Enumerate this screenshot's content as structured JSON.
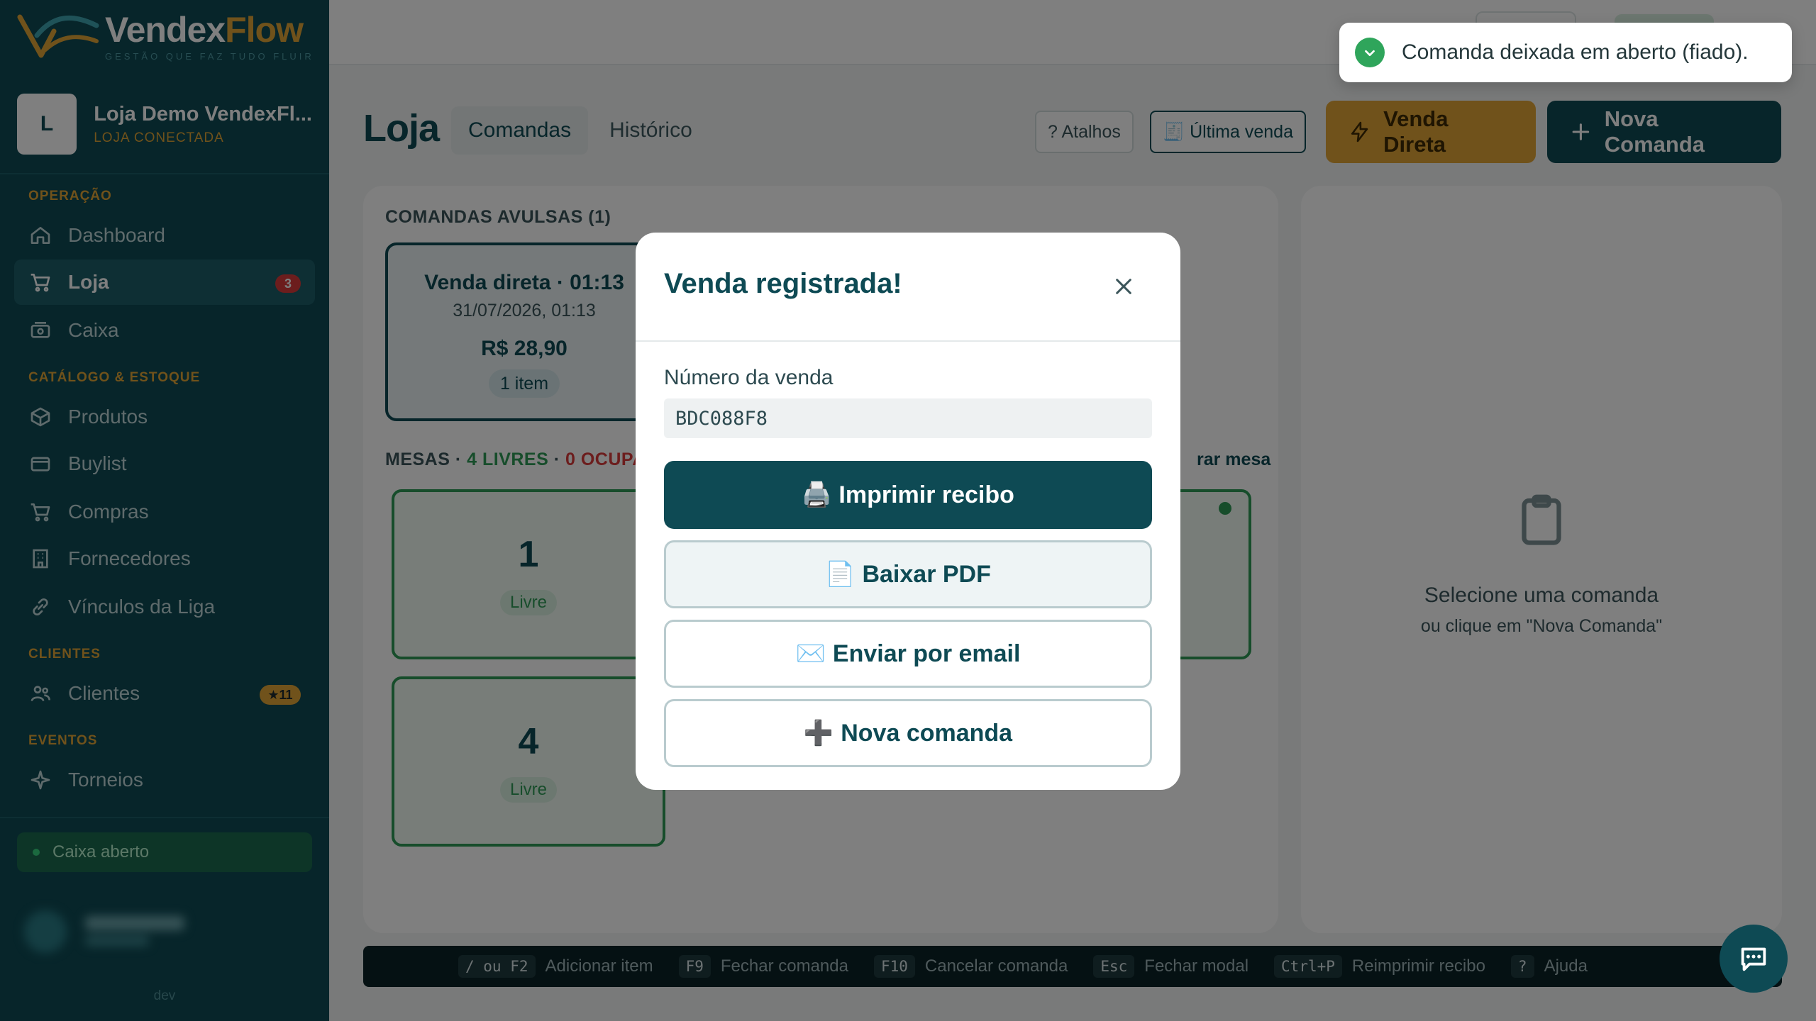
{
  "brand": {
    "name_part1": "Vendex",
    "name_part2": "Flow",
    "tagline": "GESTÃO QUE FAZ TUDO FLUIR"
  },
  "store": {
    "initial": "L",
    "name": "Loja Demo VendexFl...",
    "status": "LOJA CONECTADA"
  },
  "sidebar": {
    "sections": [
      {
        "title": "OPERAÇÃO"
      },
      {
        "title": "CATÁLOGO & ESTOQUE"
      },
      {
        "title": "CLIENTES"
      },
      {
        "title": "EVENTOS"
      }
    ],
    "items": [
      {
        "label": "Dashboard",
        "icon": "home-icon"
      },
      {
        "label": "Loja",
        "icon": "cart-icon",
        "badge": "3",
        "active": true
      },
      {
        "label": "Caixa",
        "icon": "cash-register-icon"
      },
      {
        "label": "Produtos",
        "icon": "box-icon"
      },
      {
        "label": "Buylist",
        "icon": "credit-card-icon"
      },
      {
        "label": "Compras",
        "icon": "shopping-cart-icon"
      },
      {
        "label": "Fornecedores",
        "icon": "building-icon"
      },
      {
        "label": "Vínculos da Liga",
        "icon": "link-icon"
      },
      {
        "label": "Clientes",
        "icon": "users-icon",
        "badge": "★11"
      },
      {
        "label": "Torneios",
        "icon": "sparkle-icon"
      }
    ],
    "caixa_status": "Caixa aberto",
    "env_label": "dev"
  },
  "header": {
    "title": "Loja",
    "tabs": [
      {
        "label": "Comandas",
        "active": true
      },
      {
        "label": "Histórico"
      }
    ],
    "atalhos_label": "? Atalhos",
    "ultima_venda_label": "🧾 Última venda",
    "venda_direta_label": "Venda Direta",
    "nova_comanda_label": "Nova Comanda"
  },
  "comandas": {
    "section_title": "COMANDAS AVULSAS (1)",
    "cards": [
      {
        "title": "Venda direta · 01:13",
        "date": "31/07/2026, 01:13",
        "amount": "R$ 28,90",
        "items": "1 item"
      }
    ]
  },
  "mesas": {
    "prefix": "MESAS · ",
    "livres": "4 LIVRES",
    "sep": " · ",
    "ocupadas": "0 OCUPA",
    "add_label": "rar mesa",
    "tables": [
      {
        "number": "1",
        "status": "Livre"
      },
      {
        "number": "4",
        "status": "Livre"
      }
    ]
  },
  "empty_state": {
    "title": "Selecione uma comanda",
    "subtitle": "ou clique em \"Nova Comanda\""
  },
  "shortcuts": [
    {
      "key": "/ ou F2",
      "label": "Adicionar item"
    },
    {
      "key": "F9",
      "label": "Fechar comanda"
    },
    {
      "key": "F10",
      "label": "Cancelar comanda"
    },
    {
      "key": "Esc",
      "label": "Fechar modal"
    },
    {
      "key": "Ctrl+P",
      "label": "Reimprimir recibo"
    },
    {
      "key": "?",
      "label": "Ajuda"
    }
  ],
  "modal": {
    "title": "Venda registrada!",
    "sale_number_label": "Número da venda",
    "sale_number": "BDC088F8",
    "buttons": [
      {
        "emoji": "🖨️",
        "label": "Imprimir recibo"
      },
      {
        "emoji": "📄",
        "label": "Baixar PDF"
      },
      {
        "emoji": "✉️",
        "label": "Enviar por email"
      },
      {
        "emoji": "➕",
        "label": "Nova comanda"
      }
    ]
  },
  "toast": {
    "message": "Comanda deixada em aberto (fiado)."
  },
  "colors": {
    "brand_teal": "#0e4a54",
    "accent_gold": "#e0a436",
    "success_green": "#2f9a57",
    "danger_red": "#d83a3a"
  }
}
